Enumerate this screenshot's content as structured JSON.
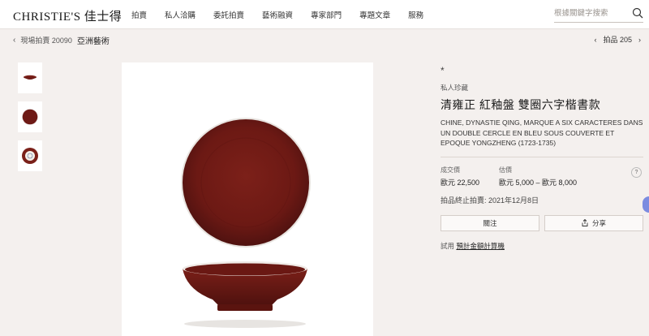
{
  "header": {
    "logo": "CHRISTIE'S 佳士得",
    "nav": [
      "拍賣",
      "私人洽購",
      "委託拍賣",
      "藝術融資",
      "專家部門",
      "專題文章",
      "服務"
    ],
    "search_placeholder": "根據關鍵字搜索"
  },
  "breadcrumb": {
    "sale": "現場拍賣 20090",
    "department": "亞洲藝術",
    "lot": "拍品 205"
  },
  "lot": {
    "symbol": "*",
    "provenance": "私人珍藏",
    "title": "清雍正 紅釉盤 雙圈六字楷書款",
    "description": "CHINE, DYNASTIE QING, MARQUE A SIX CARACTERES DANS UN DOUBLE CERCLE EN BLEU SOUS COUVERTE ET EPOQUE YONGZHENG (1723-1735)",
    "sold_label": "成交價",
    "sold_value": "歐元 22,500",
    "estimate_label": "估價",
    "estimate_value": "歐元 5,000 – 歐元 8,000",
    "help": "?",
    "ended": "拍品終止拍賣: 2021年12月8日",
    "follow_label": "關注",
    "share_label": "分享",
    "calc_prefix": "試用",
    "calc_link": "預計金額計算機"
  },
  "colors": {
    "glaze": "#6e1a16",
    "background": "#f4f0ee"
  }
}
